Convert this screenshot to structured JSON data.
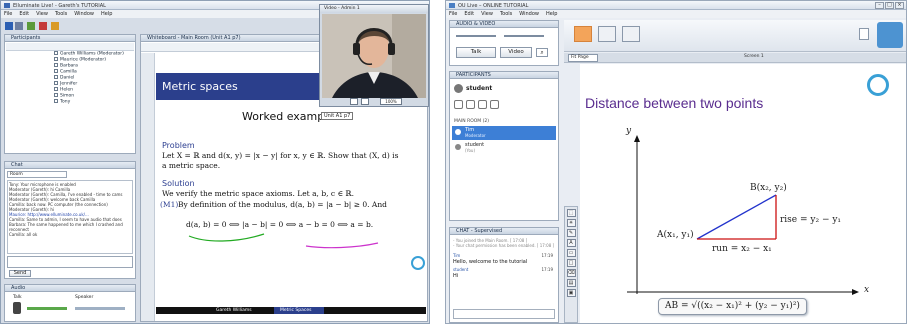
{
  "left": {
    "title": "Elluminate Live! - Gareth's TUTORIAL",
    "menu": [
      "File",
      "Edit",
      "View",
      "Tools",
      "Window",
      "Help"
    ],
    "participants_header": "Participants",
    "participants": [
      "Gareth Williams (Moderator)",
      "Maurice (Moderator)",
      "Barbara",
      "Camilla",
      "Daniel",
      "Jennifer",
      "Helen",
      "Simon",
      "Tony"
    ],
    "chat_header": "Chat",
    "chat_to": "Room",
    "chat_lines": [
      "Tony: Your microphone is enabled",
      "Moderator (Gareth): hi Camilla",
      "Moderator (Gareth): Camilla, I've enabled - time to cams",
      "Moderator (Gareth): welcome back Camilla",
      "Camilla: back now. PC computer (the connection)",
      "Moderator (Gareth): hi",
      "Maurice: http://www.elluminate.co.uk/...",
      "Camilla: Same to admin, I seem to have audio that does",
      "Barbara: The same happened to me which I crashed and",
      "reconnect",
      "Camilla: all ok"
    ],
    "send_label": "Send",
    "audio_header": "Audio",
    "talk_label": "Talk",
    "speaker_label": "Speaker",
    "whiteboard_header": "Whiteboard - Main Room (Unit A1 p7)",
    "slide": {
      "title": "Metric spaces",
      "subtitle": "Worked example",
      "unit_tag": "Unit A1 p7",
      "problem_head": "Problem",
      "problem_line1": "Let X = ℝ and d(x, y) = |x − y| for x, y ∈ ℝ. Show that (X, d) is",
      "problem_line2": "a metric space.",
      "solution_head": "Solution",
      "solution_line1": "We verify the metric space axioms. Let a, b, c ∈ ℝ.",
      "m1_label": "(M1)",
      "m1_text": "By definition of the modulus, d(a, b) = |a − b| ≥ 0. And",
      "equation": "d(a, b) = 0 ⟺ |a − b| = 0 ⟺ a − b = 0 ⟺ a = b.",
      "footer_author": "Gareth Williams",
      "footer_topic": "Metric Spaces"
    },
    "video_header": "Video - Admin 1",
    "video_zoom": "100%"
  },
  "right": {
    "title": "OU Live – ONLINE TUTORIAL",
    "menu": [
      "File",
      "Edit",
      "View",
      "Tools",
      "Window",
      "Help"
    ],
    "av_header": "AUDIO & VIDEO",
    "talk_label": "Talk",
    "video_label": "Video",
    "participants_header": "PARTICIPANTS",
    "current_user": "student",
    "room_label": "MAIN ROOM (2)",
    "participants": [
      {
        "name": "Tim",
        "role": "Moderator",
        "selected": true
      },
      {
        "name": "student",
        "role": "(You)",
        "selected": false
      }
    ],
    "chat_header": "CHAT - Supervised",
    "chat_messages": [
      {
        "who": "",
        "text": "- You joined the Main Room. [ 17:08 ]",
        "time": ""
      },
      {
        "who": "",
        "text": "- Your chat permission has been enabled. [ 17:08 ]",
        "time": ""
      },
      {
        "who": "Tim",
        "text": "Hello, welcome to the tutorial",
        "time": "17:19"
      },
      {
        "who": "student",
        "text": "Hi",
        "time": "17:19"
      }
    ],
    "fit_label": "Fit Page",
    "screen_label": "Screen 1",
    "slide": {
      "title": "Distance between two points",
      "axis_y": "y",
      "axis_x": "x",
      "point_a": "A(x₁, y₁)",
      "point_b": "B(x₂, y₂)",
      "rise": "rise = y₂ − y₁",
      "run": "run = x₂ − x₁",
      "formula": "AB = √((x₂ − x₁)² + (y₂ − y₁)²)"
    }
  },
  "colors": {
    "slide_banner": "#2b3f8c",
    "slide_heading": "#2d3f91",
    "ou_title": "#5a2d8f",
    "line_blue": "#2233cc",
    "line_red": "#cc1111",
    "participant_selected": "#3d7fd6"
  }
}
